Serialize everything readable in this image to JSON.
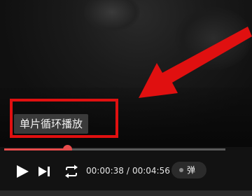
{
  "toast": {
    "text": "单片循环播放"
  },
  "player": {
    "progress_fraction": 0.285,
    "current_time": "00:00:38",
    "separator": "/",
    "total_time": "00:04:56",
    "danmu_label": "弹"
  },
  "icons": {
    "play": "play-icon",
    "next": "next-icon",
    "loop": "loop-icon",
    "annotation_arrow": "arrow-icon"
  },
  "colors": {
    "accent": "#e74c4c",
    "annotation": "#e01010",
    "toast_bg": "#3a3a3a"
  }
}
